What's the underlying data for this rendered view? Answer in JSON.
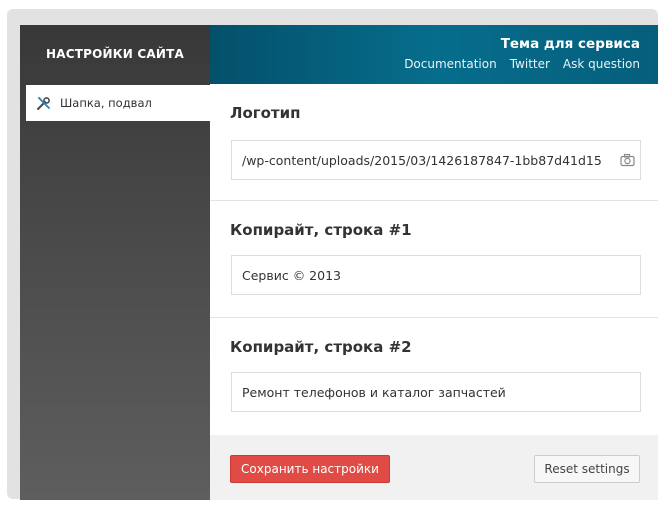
{
  "sidebar": {
    "title": "НАСТРОЙКИ САЙТА",
    "items": [
      {
        "label": "Шапка, подвал",
        "icon": "tools-icon",
        "active": true
      }
    ]
  },
  "header": {
    "title": "Тема для сервиса",
    "links": [
      {
        "label": "Documentation"
      },
      {
        "label": "Twitter"
      },
      {
        "label": "Ask question"
      }
    ]
  },
  "sections": [
    {
      "heading": "Логотип",
      "value": "/wp-content/uploads/2015/03/1426187847-1bb87d41d15",
      "icon": "camera-icon"
    },
    {
      "heading": "Копирайт, строка #1",
      "value": "Сервис © 2013"
    },
    {
      "heading": "Копирайт, строка #2",
      "value": "Ремонт телефонов и каталог запчастей"
    }
  ],
  "footer": {
    "save_label": "Сохранить настройки",
    "reset_label": "Reset settings"
  },
  "colors": {
    "header_bg": "#066d8c",
    "sidebar_bg": "#3f3f3f",
    "save_button": "#e04b45",
    "page_frame": "#e2e2e2"
  }
}
